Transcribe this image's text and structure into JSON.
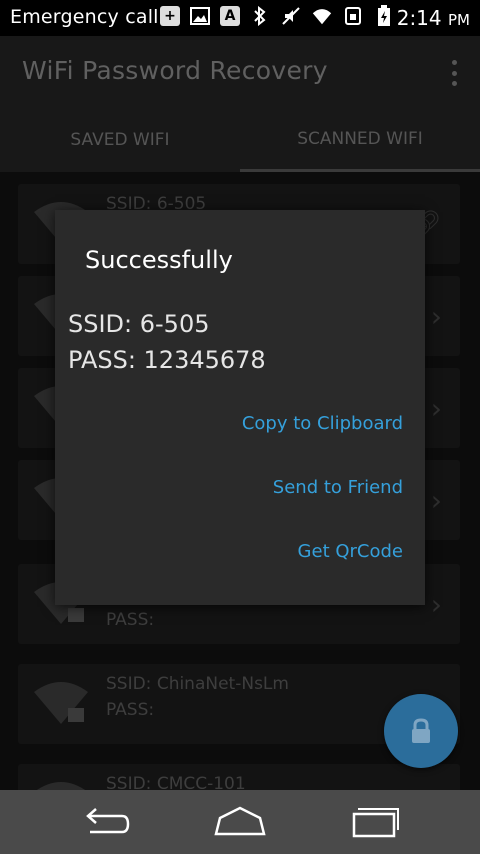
{
  "statusbar": {
    "left_text": "Emergency call...",
    "a_badge": "A",
    "time": "2:14",
    "ampm": "PM"
  },
  "app": {
    "title": "WiFi Password Recovery"
  },
  "tabs": [
    {
      "label": "SAVED WIFI"
    },
    {
      "label": "SCANNED WIFI"
    }
  ],
  "cards": [
    {
      "ssid": "SSID: 6-505",
      "pass": ""
    },
    {
      "ssid": "",
      "pass": ""
    },
    {
      "ssid": "",
      "pass": ""
    },
    {
      "ssid": "",
      "pass": ""
    },
    {
      "ssid": "",
      "pass": "PASS:"
    },
    {
      "ssid": "SSID: ChinaNet-NsLm",
      "pass": "PASS:"
    },
    {
      "ssid": "SSID: CMCC-101",
      "pass": ""
    }
  ],
  "dialog": {
    "title": "Successfully",
    "ssid_line": "SSID: 6-505",
    "pass_line": "PASS:  12345678",
    "buttons": {
      "copy": "Copy to Clipboard",
      "send": "Send to Friend",
      "qrcode": "Get QrCode"
    }
  },
  "colors": {
    "accent": "#35a0db",
    "fab": "#2b6d9b",
    "dialog_bg": "#2a2a2a"
  },
  "icons": {
    "fab": "lock-icon",
    "nav_back": "back-icon",
    "nav_home": "home-icon",
    "nav_recent": "recent-apps-icon"
  }
}
